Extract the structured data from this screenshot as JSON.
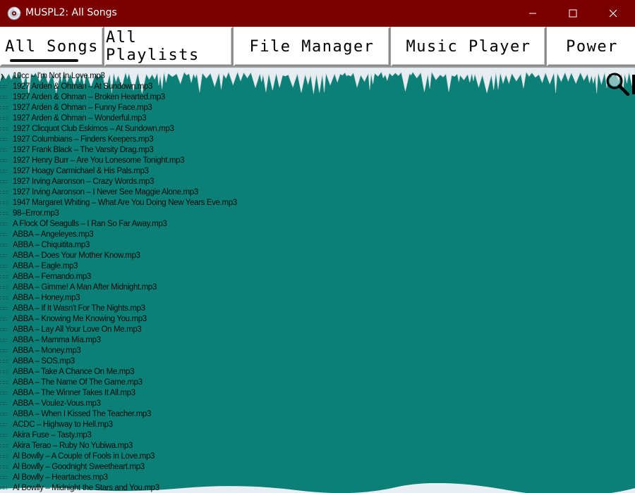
{
  "window": {
    "title": "MUSPL2: All Songs",
    "icon": "cd-icon",
    "controls": [
      "minimize-icon",
      "maximize-icon",
      "close-icon"
    ]
  },
  "tabs": [
    {
      "label": "All Songs",
      "active": true
    },
    {
      "label": "All Playlists",
      "active": false
    },
    {
      "label": "File Manager",
      "active": false
    },
    {
      "label": "Music Player",
      "active": false
    },
    {
      "label": "Power",
      "active": false
    }
  ],
  "search": {
    "icon": "search-icon"
  },
  "colors": {
    "titlebar": "#7a0000",
    "background": "#0c8077",
    "snow": "#e8eef2"
  },
  "songs": [
    {
      "bullet": "❯",
      "title": "10cc – I'm Not In Love.mp3"
    },
    {
      "bullet": "∷∷",
      "title": "1927 Arden & Ohman – At Sundown.mp3"
    },
    {
      "bullet": "∷∷",
      "title": "1927 Arden & Ohman – Broken Hearted.mp3"
    },
    {
      "bullet": "∷∷",
      "title": "1927 Arden & Ohman – Funny Face.mp3"
    },
    {
      "bullet": "∷∷",
      "title": "1927 Arden & Ohman – Wonderful.mp3"
    },
    {
      "bullet": "∷∷",
      "title": "1927 Clicquot Club Eskimos – At Sundown.mp3"
    },
    {
      "bullet": "∷∷",
      "title": "1927 Columbians – Finders Keepers.mp3"
    },
    {
      "bullet": "∷∷",
      "title": "1927 Frank Black – The Varsity Drag.mp3"
    },
    {
      "bullet": "∷∷",
      "title": "1927 Henry Burr – Are You Lonesome Tonight.mp3"
    },
    {
      "bullet": "∷∷",
      "title": "1927 Hoagy Carmichael & His Pals.mp3"
    },
    {
      "bullet": "∷∷",
      "title": "1927 Irving Aaronson – Crazy Words.mp3"
    },
    {
      "bullet": "∷∷",
      "title": "1927 Irving Aaronson – I Never See Maggie Alone.mp3"
    },
    {
      "bullet": "∷∷",
      "title": "1947 Margaret Whiting – What Are You Doing New Years Eve.mp3"
    },
    {
      "bullet": "∷∷",
      "title": "98–Error.mp3"
    },
    {
      "bullet": "∷∷",
      "title": "A Flock Of Seagulls – I Ran So Far Away.mp3"
    },
    {
      "bullet": "∷∷",
      "title": "ABBA – Angeleyes.mp3"
    },
    {
      "bullet": "∷∷",
      "title": "ABBA – Chiquitita.mp3"
    },
    {
      "bullet": "∷∷",
      "title": "ABBA – Does Your Mother Know.mp3"
    },
    {
      "bullet": "∷∷",
      "title": "ABBA – Eagle.mp3"
    },
    {
      "bullet": "∷∷",
      "title": "ABBA – Fernando.mp3"
    },
    {
      "bullet": "∷∷",
      "title": "ABBA – Gimme! A Man After Midnight.mp3"
    },
    {
      "bullet": "∷∷",
      "title": "ABBA – Honey.mp3"
    },
    {
      "bullet": "∷∷",
      "title": "ABBA – If It Wasn't For The Nights.mp3"
    },
    {
      "bullet": "∷∷",
      "title": "ABBA – Knowing Me Knowing You.mp3"
    },
    {
      "bullet": "∷∷",
      "title": "ABBA – Lay All Your Love On Me.mp3"
    },
    {
      "bullet": "∷∷",
      "title": "ABBA – Mamma Mia.mp3"
    },
    {
      "bullet": "∷∷",
      "title": "ABBA – Money.mp3"
    },
    {
      "bullet": "∷∷",
      "title": "ABBA – SOS.mp3"
    },
    {
      "bullet": "∷∷",
      "title": "ABBA – Take A Chance On Me.mp3"
    },
    {
      "bullet": "∷∷",
      "title": "ABBA – The Name Of The Game.mp3"
    },
    {
      "bullet": "∷∷",
      "title": "ABBA – The Winner Takes It All.mp3"
    },
    {
      "bullet": "∷∷",
      "title": "ABBA – Voulez-Vous.mp3"
    },
    {
      "bullet": "∷∷",
      "title": "ABBA – When I Kissed The Teacher.mp3"
    },
    {
      "bullet": "∷∷",
      "title": "ACDC – Highway to Hell.mp3"
    },
    {
      "bullet": "∷∷",
      "title": "Akira Fuse – Tasty.mp3"
    },
    {
      "bullet": "∷∷",
      "title": "Akira Terao – Ruby No Yubiwa.mp3"
    },
    {
      "bullet": "∷∷",
      "title": "Al Bowlly – A Couple of Fools in Love.mp3"
    },
    {
      "bullet": "∷∷",
      "title": "Al Bowlly – Goodnight Sweetheart.mp3"
    },
    {
      "bullet": "∷∷",
      "title": "Al Bowlly – Heartaches.mp3"
    },
    {
      "bullet": "∷∷",
      "title": "Al Bowlly – Midnight the Stars and You.mp3"
    }
  ]
}
